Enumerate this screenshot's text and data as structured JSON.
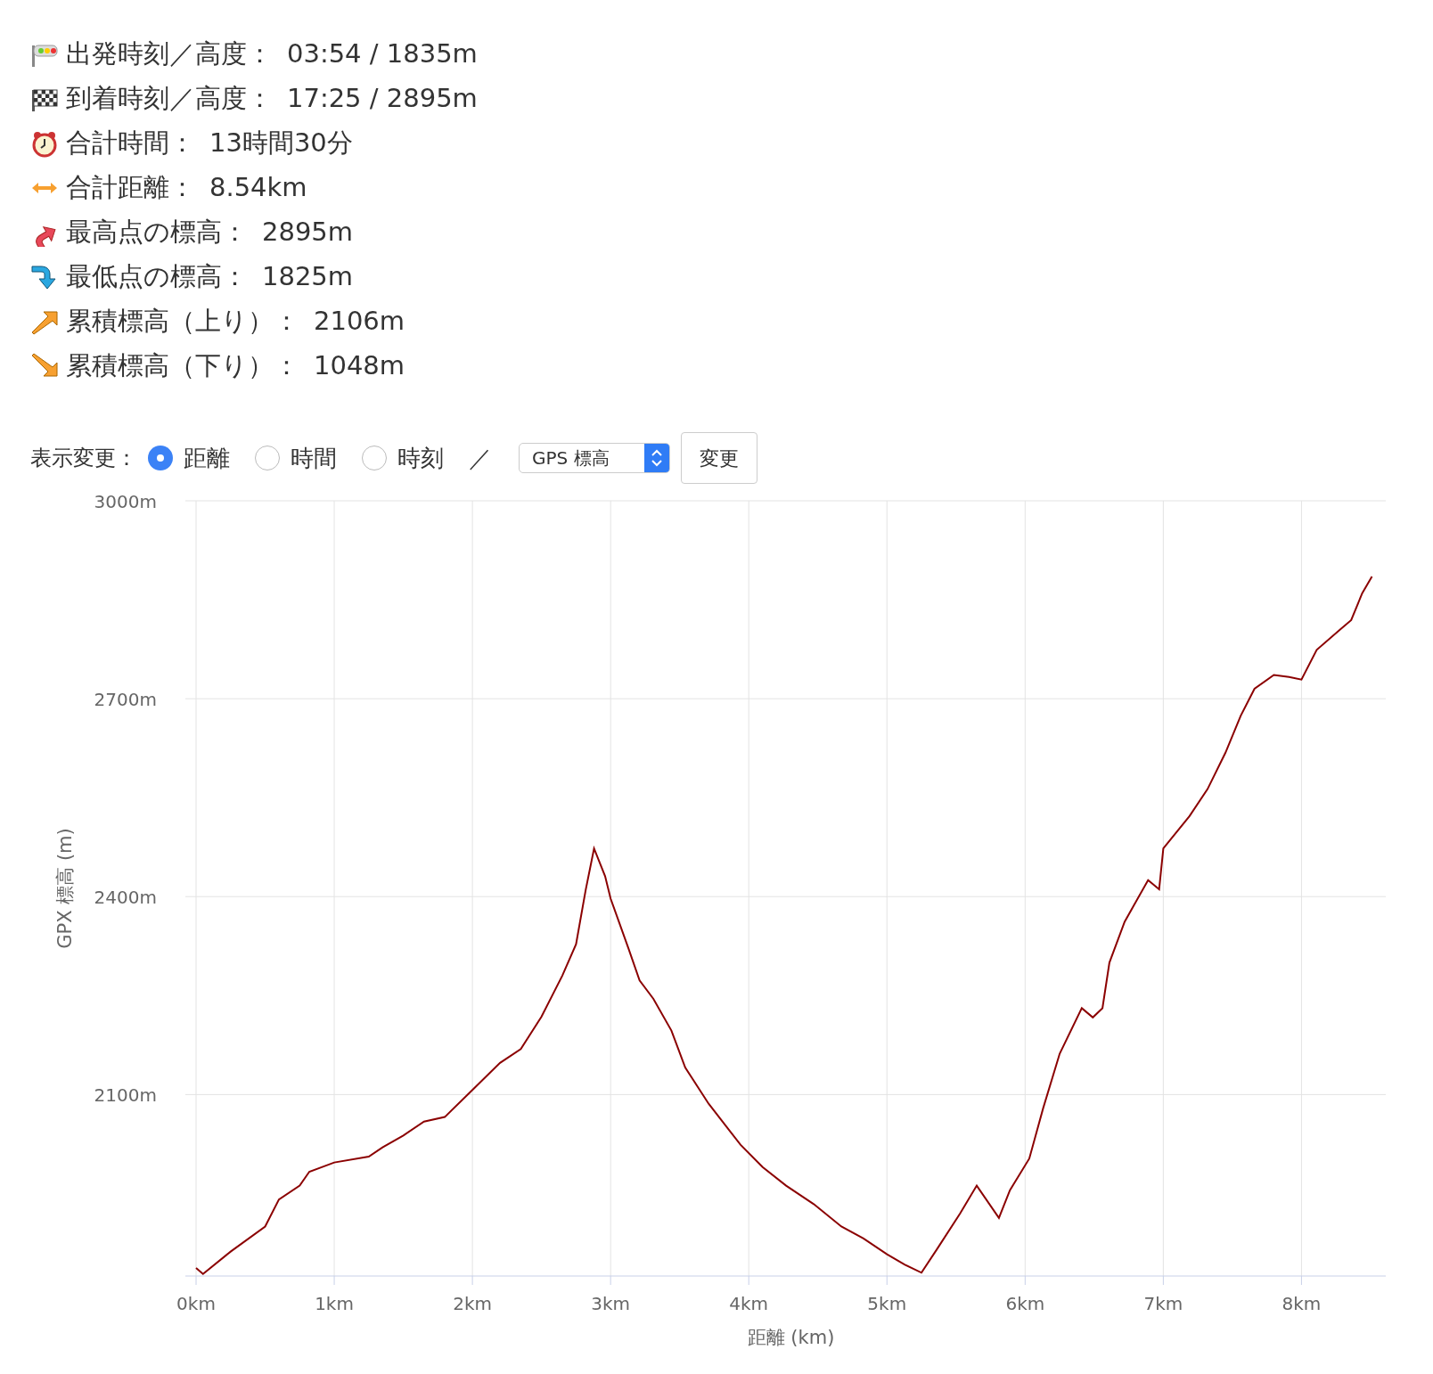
{
  "summary": [
    {
      "label": "出発時刻／高度：",
      "value": "03:54 / 1835m"
    },
    {
      "label": "到着時刻／高度：",
      "value": "17:25 / 2895m"
    },
    {
      "label": "合計時間：",
      "value": "13時間30分"
    },
    {
      "label": "合計距離：",
      "value": "8.54km"
    },
    {
      "label": "最高点の標高：",
      "value": "2895m"
    },
    {
      "label": "最低点の標高：",
      "value": "1825m"
    },
    {
      "label": "累積標高（上り）：",
      "value": "2106m"
    },
    {
      "label": "累積標高（下り）：",
      "value": "1048m"
    }
  ],
  "display_controls": {
    "label": "表示変更：",
    "options": [
      {
        "label": "距離",
        "selected": true
      },
      {
        "label": "時間",
        "selected": false
      },
      {
        "label": "時刻",
        "selected": false
      }
    ],
    "separator": "／",
    "select": {
      "value": "GPS 標高"
    },
    "button": "変更"
  },
  "chart": {
    "chart_data": {
      "type": "line",
      "grid": true,
      "xlabel": "距離 (km)",
      "ylabel": "GPX 標高 (m)",
      "xlim": [
        0,
        8.61
      ],
      "ylim": [
        1825,
        3000
      ],
      "xticks": [
        {
          "value": 0,
          "label": "0km"
        },
        {
          "value": 1,
          "label": "1km"
        },
        {
          "value": 2,
          "label": "2km"
        },
        {
          "value": 3,
          "label": "3km"
        },
        {
          "value": 4,
          "label": "4km"
        },
        {
          "value": 5,
          "label": "5km"
        },
        {
          "value": 6,
          "label": "6km"
        },
        {
          "value": 7,
          "label": "7km"
        },
        {
          "value": 8,
          "label": "8km"
        }
      ],
      "yticks": [
        {
          "value": 2100,
          "label": "2100m"
        },
        {
          "value": 2400,
          "label": "2400m"
        },
        {
          "value": 2700,
          "label": "2700m"
        },
        {
          "value": 3000,
          "label": "3000m"
        }
      ],
      "x": [
        0,
        0.05,
        0.25,
        0.5,
        0.6,
        0.75,
        0.82,
        1.0,
        1.25,
        1.35,
        1.5,
        1.65,
        1.8,
        2.0,
        2.2,
        2.35,
        2.5,
        2.65,
        2.75,
        2.82,
        2.88,
        2.96,
        3.0,
        3.13,
        3.21,
        3.31,
        3.44,
        3.54,
        3.71,
        3.94,
        4.1,
        4.27,
        4.47,
        4.67,
        4.83,
        5.0,
        5.13,
        5.25,
        5.36,
        5.53,
        5.65,
        5.81,
        5.89,
        6.03,
        6.13,
        6.25,
        6.41,
        6.49,
        6.56,
        6.61,
        6.72,
        6.89,
        6.97,
        7.0,
        7.19,
        7.32,
        7.45,
        7.56,
        7.66,
        7.8,
        7.91,
        8.0,
        8.11,
        8.28,
        8.36,
        8.44,
        8.51
      ],
      "series": [
        {
          "color": "#8b0000",
          "values": [
            1837,
            1828,
            1862,
            1900,
            1941,
            1962,
            1983,
            1997,
            2006,
            2020,
            2038,
            2059,
            2066,
            2107,
            2148,
            2169,
            2218,
            2280,
            2328,
            2410,
            2473,
            2431,
            2397,
            2321,
            2273,
            2245,
            2197,
            2141,
            2086,
            2024,
            1990,
            1962,
            1934,
            1900,
            1882,
            1858,
            1842,
            1830,
            1865,
            1920,
            1962,
            1913,
            1955,
            2003,
            2079,
            2162,
            2231,
            2217,
            2231,
            2300,
            2362,
            2425,
            2411,
            2473,
            2522,
            2563,
            2618,
            2674,
            2715,
            2736,
            2733,
            2729,
            2774,
            2805,
            2819,
            2860,
            2885
          ]
        }
      ]
    }
  }
}
